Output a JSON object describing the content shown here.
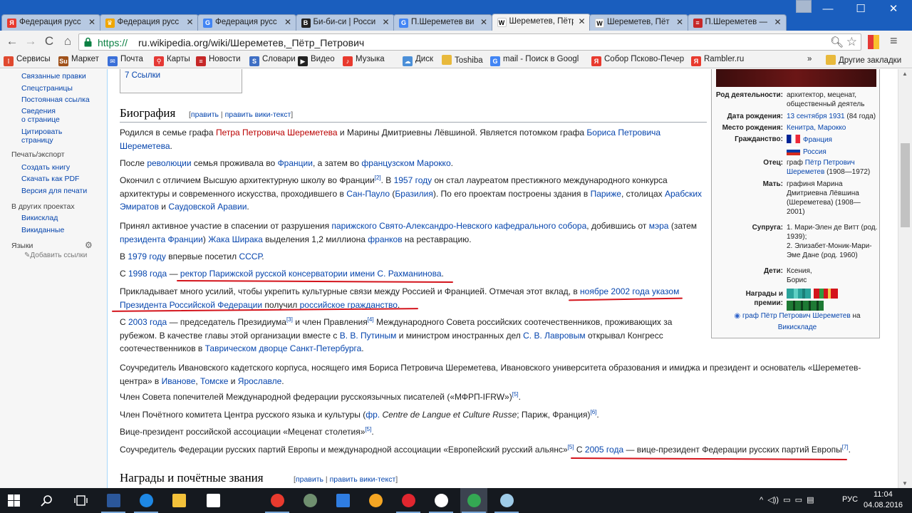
{
  "tabs": [
    {
      "label": "Федерация русс",
      "icon": "yandex-icon",
      "color": "#e83a2e",
      "glyph": "Я"
    },
    {
      "label": "Федерация русс",
      "icon": "crown-icon",
      "color": "#f0a600",
      "glyph": "♛"
    },
    {
      "label": "Федерация русс",
      "icon": "google-icon",
      "color": "#4285f4",
      "glyph": "G"
    },
    {
      "label": "Би-би-си | Росси",
      "icon": "bbc-icon",
      "color": "#222222",
      "glyph": "B"
    },
    {
      "label": "П.Шереметев ви",
      "icon": "google-icon",
      "color": "#4285f4",
      "glyph": "G"
    },
    {
      "label": "Шереметев, Пётр",
      "icon": "wikipedia-icon",
      "color": "#ffffff",
      "glyph": "W",
      "active": true
    },
    {
      "label": "Шереметев, Пёт",
      "icon": "wikipedia-icon",
      "color": "#ffffff",
      "glyph": "W"
    },
    {
      "label": "П.Шереметев —",
      "icon": "news-icon",
      "color": "#c62828",
      "glyph": "≡"
    }
  ],
  "toolbar": {
    "url_scheme": "https://",
    "url_rest": "ru.wikipedia.org/wiki/Шереметев,_Пётр_Петрович"
  },
  "bookmarks": [
    {
      "label": "Сервисы",
      "icon": "apps-icon",
      "color": "#e0492f",
      "glyph": "⁞"
    },
    {
      "label": "Маркет",
      "icon": "market-icon",
      "color": "#a0521b",
      "glyph": "Su"
    },
    {
      "label": "Почта",
      "icon": "mail-icon",
      "color": "#3a6fd8",
      "glyph": "✉"
    },
    {
      "label": "Карты",
      "icon": "map-pin-icon",
      "color": "#e53935",
      "glyph": "⚲"
    },
    {
      "label": "Новости",
      "icon": "news-icon",
      "color": "#c62828",
      "glyph": "≡"
    },
    {
      "label": "Словари",
      "icon": "dictionary-icon",
      "color": "#3f6fc4",
      "glyph": "S"
    },
    {
      "label": "Видео",
      "icon": "video-icon",
      "color": "#222222",
      "glyph": "▶"
    },
    {
      "label": "Музыка",
      "icon": "music-icon",
      "color": "#e83a2e",
      "glyph": "♪"
    },
    {
      "label": "Диск",
      "icon": "disk-icon",
      "color": "#4b8fd8",
      "glyph": "☁"
    },
    {
      "label": "Toshiba",
      "icon": "folder-icon",
      "color": "#e8b93c",
      "glyph": ""
    },
    {
      "label": "mail - Поиск в Googl",
      "icon": "google-icon",
      "color": "#4285f4",
      "glyph": "G"
    },
    {
      "label": "Собор Псково-Печер",
      "icon": "yandex-icon",
      "color": "#e83a2e",
      "glyph": "Я"
    },
    {
      "label": "Rambler.ru",
      "icon": "yandex-icon",
      "color": "#e83a2e",
      "glyph": "Я"
    }
  ],
  "bookmarks_more": "»",
  "bookmarks_other": "Другие закладки",
  "sidebar": {
    "tools": [
      "Связанные правки",
      "Спецстраницы",
      "Постоянная ссылка",
      "Сведения\nо странице",
      "Цитировать\nстраницу"
    ],
    "print_head": "Печать/экспорт",
    "print": [
      "Создать книгу",
      "Скачать как PDF",
      "Версия для печати"
    ],
    "other_head": "В других проектах",
    "other": [
      "Викисклад",
      "Викиданные"
    ],
    "lang_head": "Языки",
    "add_links": "Добавить ссылки"
  },
  "toc_item": "7  Ссылки",
  "bio": {
    "heading": "Биография",
    "edit": "править",
    "sep": " | ",
    "edit_src": "править вики-текст"
  },
  "awards_heading": {
    "heading": "Награды и почётные звания",
    "edit": "править",
    "sep": " | ",
    "edit_src": "править вики-текст"
  },
  "paragraphs": {
    "p1": {
      "a": "Родился в семье графа ",
      "l1": "Петра Петровича Шереметева",
      "b": " и Марины Дмитриевны Лёвшиной. Является потомком графа ",
      "l2": "Бориса Петровича",
      "c": "Шереметева",
      "d": "."
    },
    "p2": {
      "a": "После ",
      "l1": "революции",
      "b": " семья проживала во ",
      "l2": "Франции",
      "c": ", а затем во ",
      "l3": "французском Марокко",
      "d": "."
    },
    "p3": {
      "a": "Окончил с отличием Высшую архитектурную школу во Франции",
      "s1": "[2]",
      "b": ". В ",
      "l1": "1957 году",
      "c": " он стал лауреатом престижного международного конкурса",
      "d": "архитектуры и современного искусства, проходившего в ",
      "l2": "Сан-Пауло",
      "e": " (",
      "l3": "Бразилия",
      "f": "). По его проектам построены здания в ",
      "l4": "Париже",
      "g": ", столицах ",
      "l5": "Арабских",
      "h": "Эмиратов",
      "i": " и ",
      "l6": "Саудовской Аравии",
      "j": "."
    },
    "p4": {
      "a": "Принял активное участие в спасении от разрушения ",
      "l1": "парижского Свято-Александро-Невского кафедрального собора",
      "b": ", добившись от ",
      "l2": "мэра",
      "c": " (затем",
      "l3": "президента Франции",
      "d": ") ",
      "l4": "Жака Ширака",
      "e": " выделения 1,2 миллиона ",
      "l5": "франков",
      "f": " на реставрацию."
    },
    "p5": {
      "a": "В ",
      "l1": "1979 году",
      "b": " впервые посетил ",
      "l2": "СССР",
      "c": "."
    },
    "p6": {
      "a": "С ",
      "l1": "1998 года",
      "b": " — ",
      "l2": "ректор Парижской русской консерватории имени С. Рахманинова",
      "c": "."
    },
    "p7": {
      "a": "Прикладывает много усилий, чтобы укрепить культурные связи между Россией и Францией. Отмечая этот вклад, в ",
      "l1": "ноябре",
      "b": " ",
      "l2": "2002 года",
      "c": " ",
      "l3": "указом",
      "d": "Президента Российской Федерации",
      "e": " получил ",
      "l4": "российское гражданство",
      "f": "."
    },
    "p8": {
      "a": "С ",
      "l1": "2003 года",
      "b": " — председатель Президиума",
      "s1": "[3]",
      "c": " и член Правления",
      "s2": "[4]",
      "d": " Международного Совета российских соотечественников, проживающих за",
      "e": "рубежом. В качестве главы этой организации вместе с ",
      "l2": "В. В. Путиным",
      "f": " и министром иностранных дел ",
      "l3": "С. В. Лавровым",
      "g": " открывал Конгресс",
      "h": "соотечественников в ",
      "l4": "Таврическом дворце",
      "i": " ",
      "l5": "Санкт-Петербурга",
      "j": "."
    },
    "p9": {
      "a": "Соучредитель Ивановского кадетского корпуса, носящего имя Бориса Петровича Шереметева, Ивановского университета образования и имиджа и президент и основатель «Шереметев-",
      "b": "центра» в ",
      "l1": "Иванове",
      "c": ", ",
      "l2": "Томске",
      "d": " и ",
      "l3": "Ярославле",
      "e": "."
    },
    "p10": {
      "a": "Член Совета попечителей Международной федерации русскоязычных писателей («МФРП-IFRW»)",
      "s1": "[5]",
      "b": "."
    },
    "p11": {
      "a": "Член Почётного комитета Центра русского языка и культуры (",
      "l1": "фр.",
      "b": " ",
      "i1": "Centre de Langue et Culture Russe",
      "c": "; Париж, Франция)",
      "s1": "[6]",
      "d": "."
    },
    "p12": {
      "a": "Вице-президент российской ассоциации «Меценат столетия»",
      "s1": "[5]",
      "b": "."
    },
    "p13": {
      "a": "Соучредитель Федерации русских партий Европы и международной ассоциации «Европейский русский альянс»",
      "s1": "[5]",
      "b": " С ",
      "l1": "2005 года",
      "c": " — вице-президент Федерации русских партий Европы",
      "s2": "[7]",
      "d": "."
    }
  },
  "infobox": {
    "rows": [
      {
        "label": "Род деятельности:",
        "value": "архитектор, меценат, общественный деятель"
      },
      {
        "label": "Дата рождения:",
        "link": "13 сентября 1931",
        "value": " (84 года)"
      },
      {
        "label": "Место рождения:",
        "link": "Кенитра, Марокко"
      },
      {
        "label": "Гражданство:",
        "f1": "Франция",
        "f2": "Россия"
      },
      {
        "label": "Отец:",
        "pre": "граф ",
        "link": "Пётр Петрович Шереметев",
        "value": " (1908—1972)"
      },
      {
        "label": "Мать:",
        "value": "графиня Марина Дмитриевна Лёвшина (Шереметева) (1908—2001)"
      },
      {
        "label": "Супруга:",
        "value": "1. Мари-Элен де Витт (род. 1939);",
        "value2": "2. Элизабет-Моник-Мари-Эме Дане (род. 1960)"
      },
      {
        "label": "Дети:",
        "value": "Ксения,",
        "value2": "Борис"
      },
      {
        "label": "Награды и премии:"
      }
    ],
    "commons_link": "граф Пётр Петрович Шереметев",
    "commons_on": " на",
    "commons_site": "Викискладе"
  },
  "taskbar": {
    "apps": [
      "windows-start-icon",
      "search-icon",
      "task-view-icon",
      "word-icon",
      "edge-icon",
      "file-explorer-icon",
      "store-icon",
      "yandex-icon",
      "app-circle-icon",
      "mail-icon",
      "sun-icon",
      "opera-icon",
      "yandex-browser-icon",
      "chrome-icon",
      "app-bird-icon"
    ],
    "tray_glyphs": "^  ◁))  ▭  ▭  ▤",
    "language": "РУС",
    "time": "11:04",
    "date": "04.08.2016"
  },
  "colors": {
    "link": "#0645ad",
    "redlink": "#ba0000",
    "annotation": "#d4141c",
    "tabstrip": "#1a5ebe",
    "taskbar": "#15191f"
  }
}
